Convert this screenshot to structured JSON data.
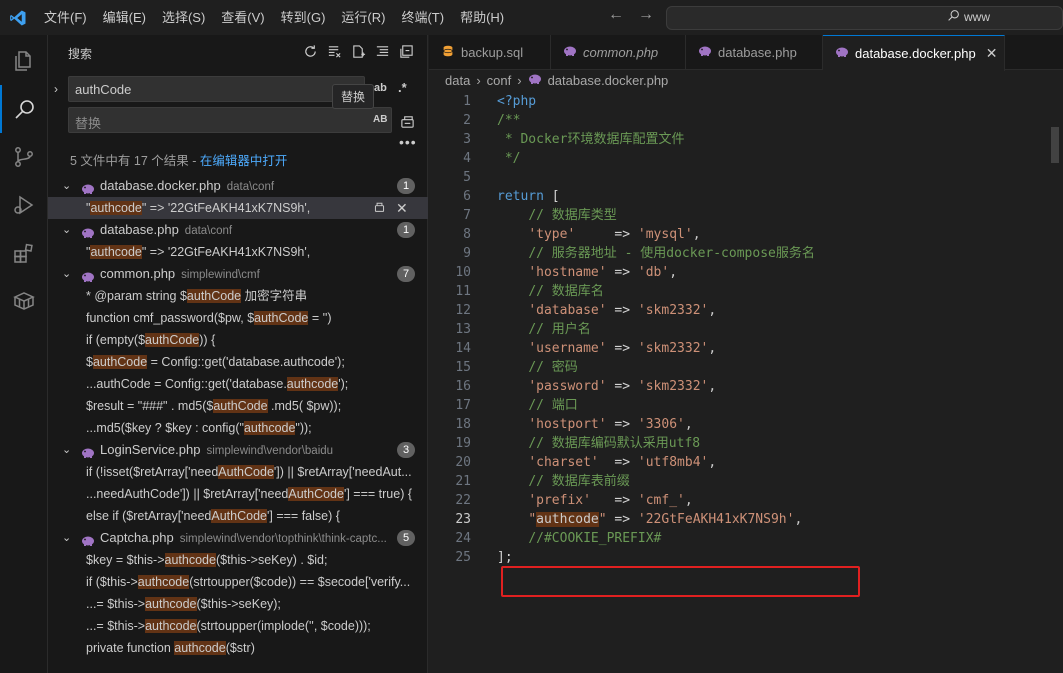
{
  "titlebar": {
    "menu": [
      "文件(F)",
      "编辑(E)",
      "选择(S)",
      "查看(V)",
      "转到(G)",
      "运行(R)",
      "终端(T)",
      "帮助(H)"
    ],
    "search_text": "www"
  },
  "sidebar": {
    "title": "搜索",
    "search_value": "authCode",
    "replace_placeholder": "替换",
    "tooltip": "替换",
    "opt_ab": "ab",
    "opt_regex": ".*",
    "opt_AB": "AB",
    "result_summary": "5 文件中有 17 个结果 - ",
    "open_in_editor": "在编辑器中打开",
    "files": [
      {
        "name": "database.docker.php",
        "path": "data\\conf",
        "count": "1",
        "matches": [
          {
            "pre": "\"",
            "hl": "authcode",
            "post": "\" => '22GtFeAKH41xK7NS9h',"
          }
        ]
      },
      {
        "name": "database.php",
        "path": "data\\conf",
        "count": "1",
        "matches": [
          {
            "pre": "\"",
            "hl": "authcode",
            "post": "\" => '22GtFeAKH41xK7NS9h',"
          }
        ]
      },
      {
        "name": "common.php",
        "path": "simplewind\\cmf",
        "count": "7",
        "matches": [
          {
            "pre": "* @param string $",
            "hl": "authCode",
            "post": " 加密字符串"
          },
          {
            "pre": "function cmf_password($pw, $",
            "hl": "authCode",
            "post": " = '')"
          },
          {
            "pre": "if (empty($",
            "hl": "authCode",
            "post": ")) {"
          },
          {
            "pre": "$",
            "hl": "authCode",
            "post": " = Config::get('database.authcode');"
          },
          {
            "pre": "...authCode = Config::get('database.",
            "hl": "authcode",
            "post": "');"
          },
          {
            "pre": "$result = \"###\" . md5($",
            "hl": "authCode",
            "post": " .md5( $pw));"
          },
          {
            "pre": "...md5($key ? $key : config(\"",
            "hl": "authcode",
            "post": "\"));"
          }
        ]
      },
      {
        "name": "LoginService.php",
        "path": "simplewind\\vendor\\baidu",
        "count": "3",
        "matches": [
          {
            "pre": "if (!isset($retArray['need",
            "hl": "AuthCode",
            "post": "']) || $retArray['needAut..."
          },
          {
            "pre": "...needAuthCode']) || $retArray['need",
            "hl": "AuthCode",
            "post": "'] === true) {"
          },
          {
            "pre": "else if ($retArray['need",
            "hl": "AuthCode",
            "post": "'] === false) {"
          }
        ]
      },
      {
        "name": "Captcha.php",
        "path": "simplewind\\vendor\\topthink\\think-captc...",
        "count": "5",
        "matches": [
          {
            "pre": "$key = $this->",
            "hl": "authcode",
            "post": "($this->seKey) . $id;"
          },
          {
            "pre": "if ($this->",
            "hl": "authcode",
            "post": "(strtoupper($code)) == $secode['verify..."
          },
          {
            "pre": "...= $this->",
            "hl": "authcode",
            "post": "($this->seKey);"
          },
          {
            "pre": "...= $this->",
            "hl": "authcode",
            "post": "(strtoupper(implode('', $code)));"
          },
          {
            "pre": "private function ",
            "hl": "authcode",
            "post": "($str)"
          }
        ]
      }
    ]
  },
  "editor": {
    "tabs": [
      {
        "label": "backup.sql",
        "italic": false
      },
      {
        "label": "common.php",
        "italic": true
      },
      {
        "label": "database.php",
        "italic": false
      },
      {
        "label": "database.docker.php",
        "italic": false,
        "active": true
      }
    ],
    "breadcrumb": [
      "data",
      "conf",
      "database.docker.php"
    ],
    "current_line": "23",
    "lines": [
      {
        "n": "1",
        "html": "<span class='phptag'>&lt;?php</span>"
      },
      {
        "n": "2",
        "html": "<span class='cm'>/**</span>"
      },
      {
        "n": "3",
        "html": "<span class='cm'> * Docker环境数据库配置文件</span>"
      },
      {
        "n": "4",
        "html": "<span class='cm'> */</span>"
      },
      {
        "n": "5",
        "html": ""
      },
      {
        "n": "6",
        "html": "<span class='kw'>return</span> <span class='op'>[</span>"
      },
      {
        "n": "7",
        "html": "    <span class='cm'>// 数据库类型</span>"
      },
      {
        "n": "8",
        "html": "    <span class='str'>'type'</span>     <span class='op'>=&gt;</span> <span class='str'>'mysql'</span>,"
      },
      {
        "n": "9",
        "html": "    <span class='cm'>// 服务器地址 - 使用docker-compose服务名</span>"
      },
      {
        "n": "10",
        "html": "    <span class='str'>'hostname'</span> <span class='op'>=&gt;</span> <span class='str'>'db'</span>,"
      },
      {
        "n": "11",
        "html": "    <span class='cm'>// 数据库名</span>"
      },
      {
        "n": "12",
        "html": "    <span class='str'>'database'</span> <span class='op'>=&gt;</span> <span class='str'>'skm2332'</span>,"
      },
      {
        "n": "13",
        "html": "    <span class='cm'>// 用户名</span>"
      },
      {
        "n": "14",
        "html": "    <span class='str'>'username'</span> <span class='op'>=&gt;</span> <span class='str'>'skm2332'</span>,"
      },
      {
        "n": "15",
        "html": "    <span class='cm'>// 密码</span>"
      },
      {
        "n": "16",
        "html": "    <span class='str'>'password'</span> <span class='op'>=&gt;</span> <span class='str'>'skm2332'</span>,"
      },
      {
        "n": "17",
        "html": "    <span class='cm'>// 端口</span>"
      },
      {
        "n": "18",
        "html": "    <span class='str'>'hostport'</span> <span class='op'>=&gt;</span> <span class='str'>'3306'</span>,"
      },
      {
        "n": "19",
        "html": "    <span class='cm'>// 数据库编码默认采用utf8</span>"
      },
      {
        "n": "20",
        "html": "    <span class='str'>'charset'</span>  <span class='op'>=&gt;</span> <span class='str'>'utf8mb4'</span>,"
      },
      {
        "n": "21",
        "html": "    <span class='cm'>// 数据库表前缀</span>"
      },
      {
        "n": "22",
        "html": "    <span class='str'>'prefix'</span>   <span class='op'>=&gt;</span> <span class='str'>'cmf_'</span>,"
      },
      {
        "n": "23",
        "html": "    <span class='str'>\"<span class='hl'>authcode</span>\"</span> <span class='op'>=&gt;</span> <span class='str'>'22GtFeAKH41xK7NS9h'</span>,"
      },
      {
        "n": "24",
        "html": "    <span class='cm'>//#COOKIE_PREFIX#</span>"
      },
      {
        "n": "25",
        "html": "<span class='op'>];</span>"
      }
    ]
  }
}
